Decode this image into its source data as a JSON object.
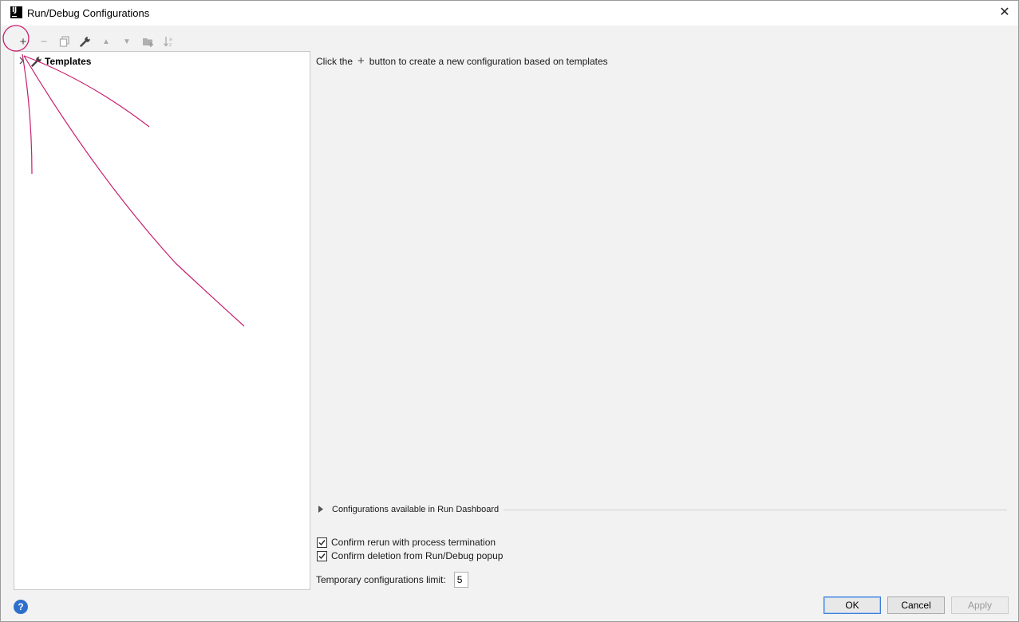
{
  "window": {
    "title": "Run/Debug Configurations",
    "close_symbol": "✕"
  },
  "app_icon": {
    "label": "IJ"
  },
  "toolbar": {
    "add": "+",
    "remove": "−",
    "up": "▲",
    "down": "▼"
  },
  "tree": {
    "root_label": "Templates"
  },
  "main": {
    "hint_before": "Click the",
    "hint_plus": "+",
    "hint_after": "button to create a new configuration based on templates",
    "dashboard_label": "Configurations available in Run Dashboard",
    "confirm_rerun": "Confirm rerun with process termination",
    "confirm_deletion": "Confirm deletion from Run/Debug popup",
    "confirm_rerun_checked": true,
    "confirm_deletion_checked": true,
    "limit_label": "Temporary configurations limit:",
    "limit_value": "5"
  },
  "buttons": {
    "help": "?",
    "ok": "OK",
    "cancel": "Cancel",
    "apply": "Apply"
  },
  "colors": {
    "annotation": "#c81e6e",
    "accent": "#3c7dd8",
    "help_blue": "#2f6fcc"
  }
}
